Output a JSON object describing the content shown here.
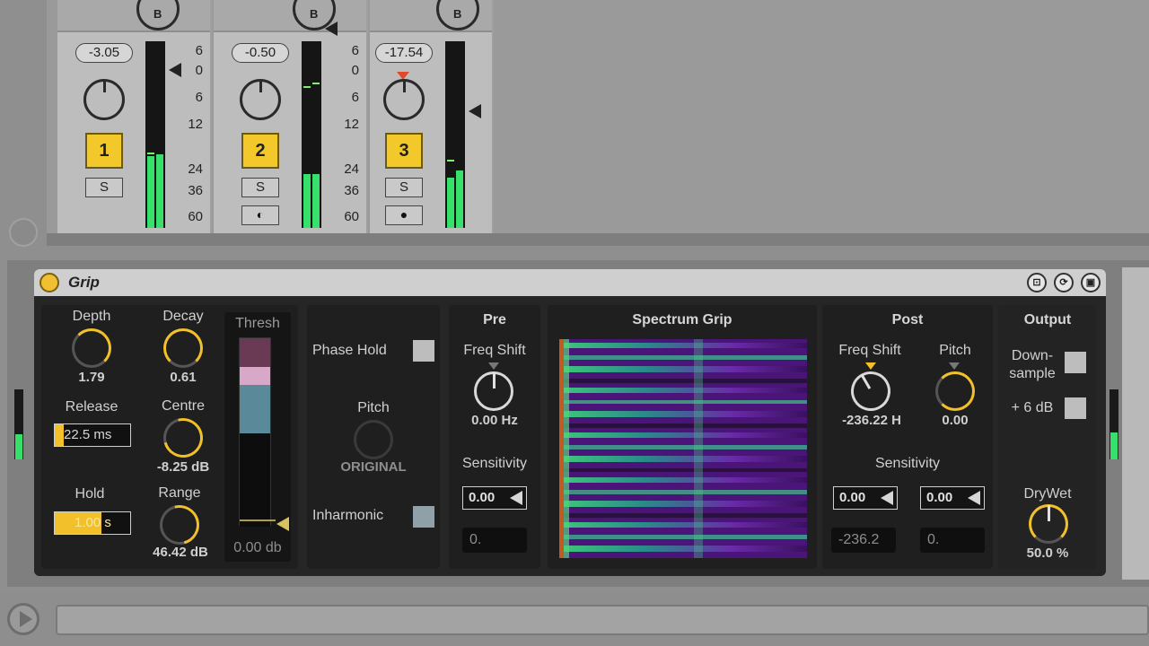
{
  "mixer": {
    "tracks": [
      {
        "number": "1",
        "volume": "-3.05",
        "solo": "S",
        "pan_label": "B",
        "has_arm": false,
        "meter_level": 0.38,
        "meter_level2": 0.4
      },
      {
        "number": "2",
        "volume": "-0.50",
        "solo": "S",
        "pan_label": "B",
        "has_arm": true,
        "arm_glyph": "◐",
        "meter_level": 0.29,
        "meter_level2": 0.29
      },
      {
        "number": "3",
        "volume": "-17.54",
        "solo": "S",
        "pan_label": "B",
        "has_arm": true,
        "arm_glyph": "●",
        "meter_level": 0.27,
        "meter_level2": 0.31
      }
    ],
    "scale": [
      "6",
      "0",
      "6",
      "12",
      "24",
      "36",
      "60"
    ]
  },
  "device": {
    "title": "Grip",
    "icons": [
      "⊡",
      "⟳",
      "▣"
    ],
    "depth": {
      "label": "Depth",
      "value": "1.79"
    },
    "decay": {
      "label": "Decay",
      "value": "0.61"
    },
    "release": {
      "label": "Release",
      "value": "22.5 ms",
      "fill": 0.12
    },
    "centre": {
      "label": "Centre",
      "value": "-8.25 dB"
    },
    "hold": {
      "label": "Hold",
      "value": "1.00 s",
      "fill": 0.62
    },
    "range": {
      "label": "Range",
      "value": "46.42 dB"
    },
    "thresh": {
      "label": "Thresh",
      "value": "0.00 db"
    },
    "phase_hold": "Phase Hold",
    "pitch": {
      "label": "Pitch",
      "value": "ORIGINAL"
    },
    "inharmonic": "Inharmonic",
    "pre": {
      "title": "Pre",
      "freq_shift_label": "Freq Shift",
      "freq_shift_value": "0.00 Hz",
      "sensitivity_label": "Sensitivity",
      "sensitivity_value": "0.00",
      "box_value": "0."
    },
    "spectrum_title": "Spectrum Grip",
    "post": {
      "title": "Post",
      "freq_shift_label": "Freq Shift",
      "freq_shift_value": "-236.22 H",
      "pitch_label": "Pitch",
      "pitch_value": "0.00",
      "sensitivity_label": "Sensitivity",
      "sens_a": "0.00",
      "sens_b": "0.00",
      "box_a": "-236.2",
      "box_b": "0."
    },
    "output": {
      "title": "Output",
      "downsample_line1": "Down-",
      "downsample_line2": "sample",
      "plus6": "+ 6 dB",
      "drywet_label": "DryWet",
      "drywet_value": "50.0 %"
    }
  },
  "colors": {
    "accent": "#f2c02a",
    "meter_green": "#36e06a",
    "spectrum_purple": "#5a1a8a",
    "spectrum_green": "#3ec77a"
  }
}
